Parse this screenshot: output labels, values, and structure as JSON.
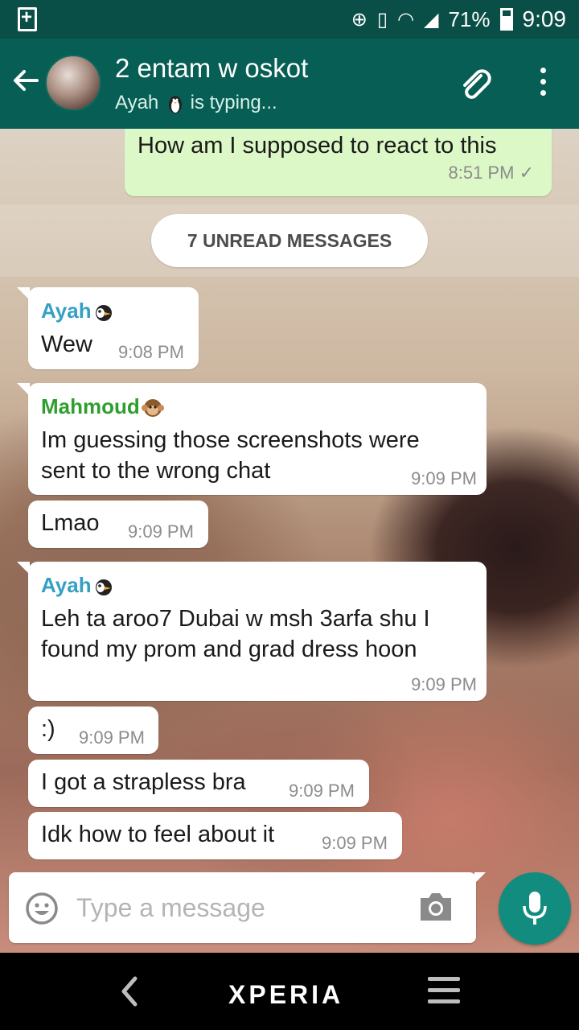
{
  "status_bar": {
    "battery_percent": "71%",
    "time": "9:09"
  },
  "header": {
    "title": "2 entam w oskot",
    "typing_name": "Ayah",
    "typing_status": "is typing..."
  },
  "previous_message": {
    "text": "How am I supposed to react to this",
    "time": "8:51 PM",
    "status": "✓"
  },
  "unread_label": "7 UNREAD MESSAGES",
  "messages": [
    {
      "sender": "Ayah",
      "sender_color": "#35a0c6",
      "lines": [
        "Wew"
      ],
      "time": "9:08 PM"
    },
    {
      "sender": "Mahmoud",
      "sender_color": "#2f9e2f",
      "lines": [
        "Im guessing those screenshots were",
        "sent to the wrong chat"
      ],
      "time": "9:09 PM"
    },
    {
      "lines": [
        "Lmao"
      ],
      "time": "9:09 PM"
    },
    {
      "sender": "Ayah",
      "sender_color": "#35a0c6",
      "lines": [
        "Leh ta aroo7 Dubai w msh 3arfa shu I",
        "found my prom and grad dress hoon"
      ],
      "time": "9:09 PM"
    },
    {
      "lines": [
        ":)"
      ],
      "time": "9:09 PM"
    },
    {
      "lines": [
        "I got a strapless bra"
      ],
      "time": "9:09 PM"
    },
    {
      "lines": [
        "Idk how to feel about it"
      ],
      "time": "9:09 PM"
    }
  ],
  "input": {
    "placeholder": "Type a message"
  },
  "nav": {
    "brand": "XPERIA"
  },
  "colors": {
    "status_bar": "#0a4f47",
    "app_bar": "#075e54",
    "outgoing_bubble": "#dcf8c6",
    "mic_button": "#128c7e"
  }
}
